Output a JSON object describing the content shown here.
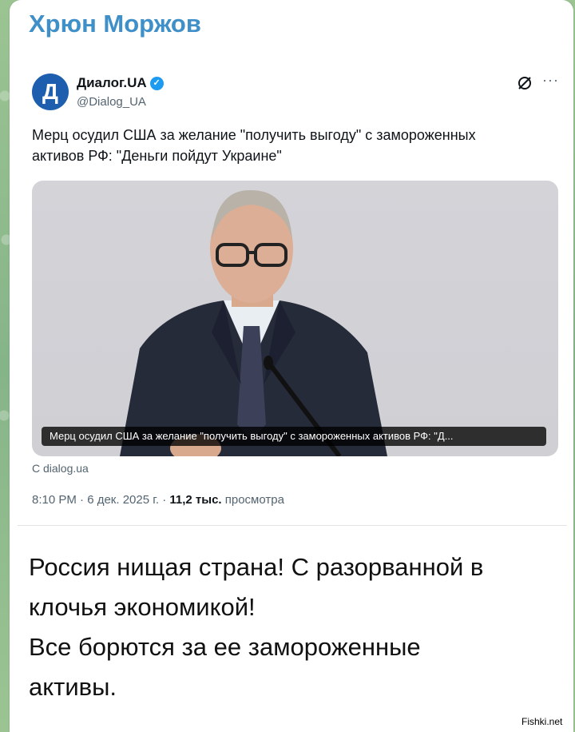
{
  "channel_post": {
    "sender_name": "Хрюн Моржов",
    "message_lines": [
      "Россия нищая страна! С разорванной в",
      "клочья экономикой!",
      "Все борются за ее замороженные",
      "активы."
    ]
  },
  "tweet": {
    "avatar_letter": "Д",
    "account_name": "Диалог.UA",
    "verified": true,
    "handle": "@Dialog_UA",
    "text_lines": [
      "Мерц осудил США за желание \"получить выгоду\" с замороженных",
      "активов РФ: \"Деньги пойдут Украине\""
    ],
    "card_caption": "Мерц осудил США за желание \"получить выгоду\" с замороженных активов РФ: \"Д...",
    "source_link": "С dialog.ua",
    "time_date": "8:10 PM · 6 дек. 2025 г. · ",
    "views_count": "11,2 тыс.",
    "views_label": " просмотра",
    "icons": [
      "grok-icon",
      "more-icon",
      "verified-badge-icon"
    ]
  },
  "watermark": "Fishki.net",
  "colors": {
    "sender": "#3f8fc9",
    "avatar": "#1d5fae",
    "verified": "#1d9bf0",
    "background": "#8fb98a"
  }
}
